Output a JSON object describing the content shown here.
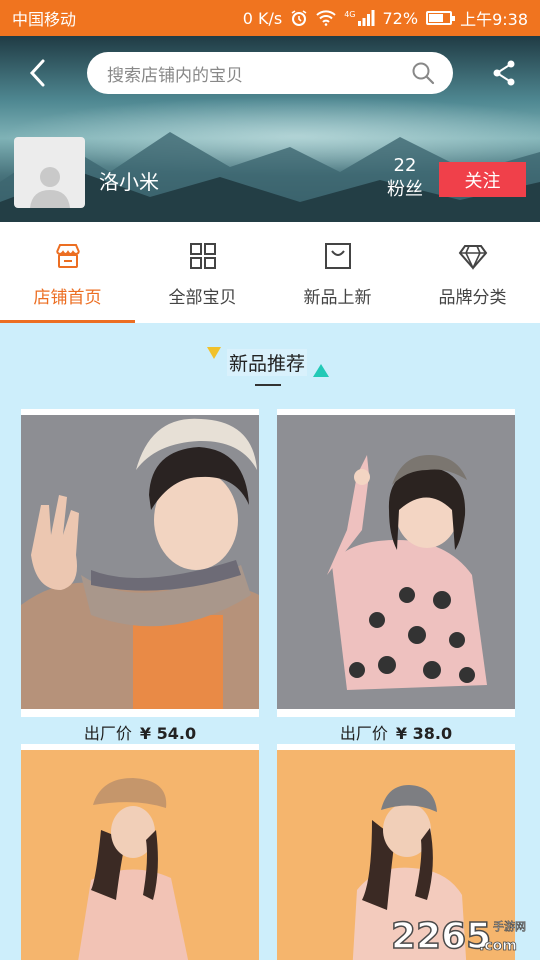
{
  "status_bar": {
    "carrier": "中国移动",
    "speed": "0 K/s",
    "network": "4G",
    "battery": "72%",
    "battery_level": 0.72,
    "time": "上午9:38"
  },
  "header": {
    "search_placeholder": "搜索店铺内的宝贝",
    "shop_name": "洛小米",
    "fans_count": "22",
    "fans_label": "粉丝",
    "follow_label": "关注"
  },
  "tabs": [
    {
      "label": "店铺首页",
      "icon": "store-icon",
      "active": true
    },
    {
      "label": "全部宝贝",
      "icon": "grid-icon",
      "active": false
    },
    {
      "label": "新品上新",
      "icon": "bag-icon",
      "active": false
    },
    {
      "label": "品牌分类",
      "icon": "diamond-icon",
      "active": false
    }
  ],
  "section": {
    "title": "新品推荐"
  },
  "products": [
    {
      "price_label": "出厂价",
      "price": "¥ 54.0"
    },
    {
      "price_label": "出厂价",
      "price": "¥ 38.0"
    },
    {
      "price_label": "",
      "price": ""
    },
    {
      "price_label": "",
      "price": ""
    }
  ],
  "watermark": {
    "brand": "2265",
    "suffix": ".com",
    "label": "手游网"
  },
  "colors": {
    "status_bar": "#f0741f",
    "accent": "#ec6e22",
    "follow": "#f0404a",
    "page_bg": "#cdeefb"
  }
}
